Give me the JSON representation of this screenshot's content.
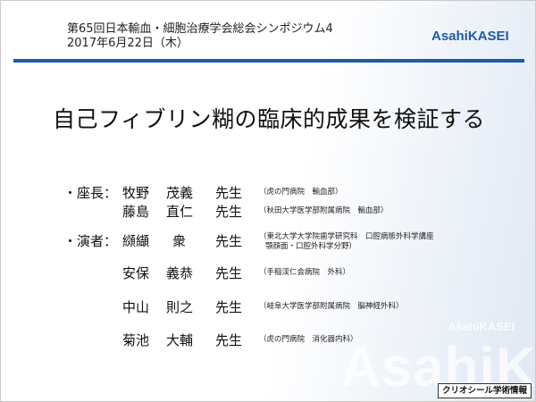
{
  "header": {
    "event": "第65回日本輸血・細胞治療学会総会シンポジウム4",
    "date": "2017年6月22日（木）",
    "logo_text": "Asahi",
    "logo_text_bold": "KASEI"
  },
  "title": "自己フィブリン糊の臨床的成果を検証する",
  "chairs": {
    "role": "・座長：",
    "people": [
      {
        "name_family": "牧野",
        "name_given": "茂義",
        "honorific": "先生",
        "affiliation": [
          "（虎の門病院　輸血部）"
        ]
      },
      {
        "name_family": "藤島",
        "name_given": "直仁",
        "honorific": "先生",
        "affiliation": [
          "（秋田大学医学部附属病院　輸血部）"
        ]
      }
    ]
  },
  "speakers": {
    "role": "・演者：",
    "people": [
      {
        "name_family": "纐纈",
        "name_given": "衆",
        "honorific": "先生",
        "affiliation": [
          "（東北大学大学院歯学研究科　口腔病態外科学講座",
          "顎顔面・口腔外科学分野）"
        ]
      },
      {
        "name_family": "安保",
        "name_given": "義恭",
        "honorific": "先生",
        "affiliation": [
          "（手稲渓仁会病院　外科）"
        ]
      },
      {
        "name_family": "中山",
        "name_given": "則之",
        "honorific": "先生",
        "affiliation": [
          "（岐阜大学医学部附属病院　脳神経外科）"
        ]
      },
      {
        "name_family": "菊池",
        "name_given": "大輔",
        "honorific": "先生",
        "affiliation": [
          "（虎の門病院　消化器内科）"
        ]
      }
    ]
  },
  "watermark": {
    "small": "AsahiKASEI",
    "large": "AsahiKA"
  },
  "footer": {
    "badge": "クリオシール学術情報"
  },
  "colors": {
    "brand_blue": "#1f5aa6"
  }
}
